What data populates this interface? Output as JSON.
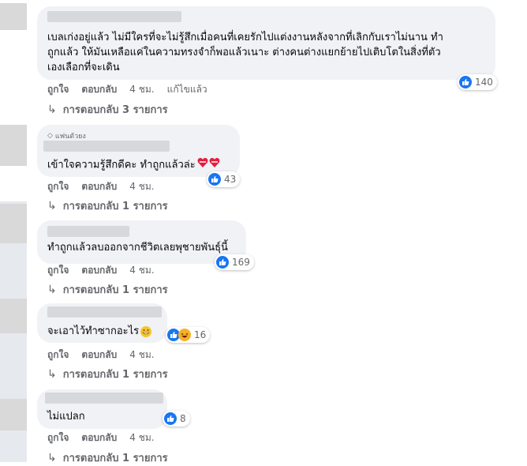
{
  "comments": [
    {
      "badge": "",
      "text_lines": [
        "เบลเก่งอยู่แล้ว ไม่มีใครที่จะไม่รู้สึกเมื่อคนที่เคยรักไปแต่งงานหลังจากที่เลิกกับเราไม่นาน ทำ",
        "ถูกแล้ว ให้มันเหลือแค่ในความทรงจำก็พอแล้วเนาะ ต่างคนต่างแยกย้ายไปเติบโตในสิ่งที่ตัว",
        "เองเลือกที่จะเดิน"
      ],
      "like_label": "ถูกใจ",
      "reply_label": "ตอบกลับ",
      "time": "4 ชม.",
      "edited": "แก้ไขแล้ว",
      "reaction_count": "140",
      "replies": "การตอบกลับ 3 รายการ"
    },
    {
      "badge": "แฟนตัวยง",
      "text_lines": [
        "เข้าใจความรู้สึกดีคะ ทำถูกแล้วล่ะ"
      ],
      "like_label": "ถูกใจ",
      "reply_label": "ตอบกลับ",
      "time": "4 ชม.",
      "reaction_count": "43",
      "replies": "การตอบกลับ 1 รายการ"
    },
    {
      "text_lines": [
        "ทำถูกแล้วลบออกจากชีวิตเลยพุชายพันธุ์นี้"
      ],
      "like_label": "ถูกใจ",
      "reply_label": "ตอบกลับ",
      "time": "4 ชม.",
      "reaction_count": "169",
      "replies": "การตอบกลับ 1 รายการ"
    },
    {
      "text_lines": [
        "จะเอาไว้ทำซากอะไร"
      ],
      "like_label": "ถูกใจ",
      "reply_label": "ตอบกลับ",
      "time": "4 ชม.",
      "reaction_count": "16",
      "replies": "การตอบกลับ 1 รายการ"
    },
    {
      "text_lines": [
        "ไม่แปลก"
      ],
      "like_label": "ถูกใจ",
      "reply_label": "ตอบกลับ",
      "time": "4 ชม.",
      "reaction_count": "8",
      "replies": "การตอบกลับ 1 รายการ"
    }
  ],
  "colors": {
    "bubble_bg": "#f0f2f5",
    "meta_text": "#65676b",
    "like_blue": "#1877f2",
    "haha_yellow": "#f7b125",
    "heart_red": "#e41e3f"
  },
  "icons": [
    "thumbs-up-icon",
    "haha-icon",
    "reply-arrow-icon",
    "diamond-badge-icon",
    "heart-emoji-icon",
    "grin-emoji-icon"
  ]
}
